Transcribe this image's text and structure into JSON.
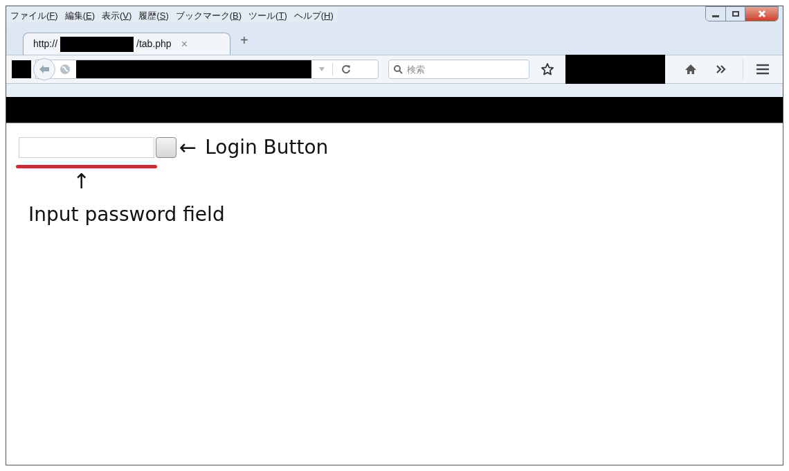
{
  "menu": [
    {
      "before": "ファイル(",
      "key": "F",
      "after": ")"
    },
    {
      "before": "編集(",
      "key": "E",
      "after": ")"
    },
    {
      "before": "表示(",
      "key": "V",
      "after": ")"
    },
    {
      "before": "履歴(",
      "key": "S",
      "after": ")"
    },
    {
      "before": "ブックマーク(",
      "key": "B",
      "after": ")"
    },
    {
      "before": "ツール(",
      "key": "T",
      "after": ")"
    },
    {
      "before": "ヘルプ(",
      "key": "H",
      "after": ")"
    }
  ],
  "tabs": [
    {
      "prefix": "http://",
      "suffix": "/tab.php",
      "close": "×",
      "selected": true
    }
  ],
  "new_tab": "+",
  "search": {
    "placeholder": "検索"
  },
  "page": {
    "login_arrow": "←",
    "login_label": "Login Button",
    "field_arrow": "↑",
    "field_label": "Input password field"
  }
}
